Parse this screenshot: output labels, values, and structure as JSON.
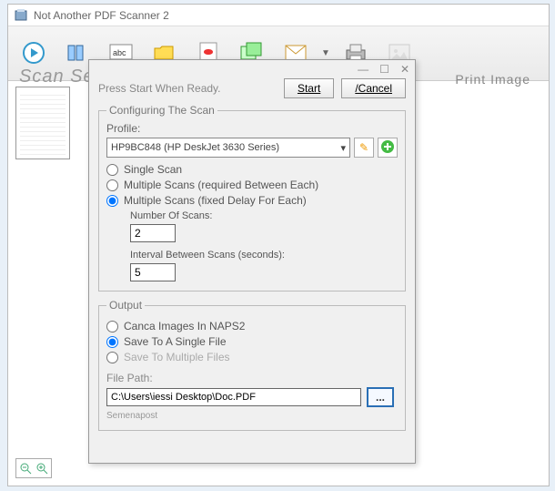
{
  "window": {
    "title": "Not Another PDF Scanner 2"
  },
  "overlay_title": "Scan Serial Scan",
  "toolbar": {
    "print_label": "Print Image"
  },
  "dialog": {
    "instruction": "Press Start When Ready.",
    "start_label": "Start",
    "cancel_label": "/Cancel",
    "config_legend": "Configuring The Scan",
    "profile_label": "Profile:",
    "profile_value": "HP9BC848 (HP DeskJet 3630 Series)",
    "radio_single": "Single Scan",
    "radio_multi_btw": "Multiple Scans (required Between Each)",
    "radio_multi_delay": "Multiple Scans (fixed Delay For Each)",
    "num_scans_label": "Number Of Scans:",
    "num_scans_value": "2",
    "interval_label": "Interval Between Scans (seconds):",
    "interval_value": "5",
    "output_legend": "Output",
    "radio_canca": "Canca Images In NAPS2",
    "radio_single_file": "Save To A Single File",
    "radio_multi_file": "Save To Multiple Files",
    "filepath_label": "File Path:",
    "filepath_value": "C:\\Users\\iessi Desktop\\Doc.PDF",
    "footer": "Semenapost"
  }
}
